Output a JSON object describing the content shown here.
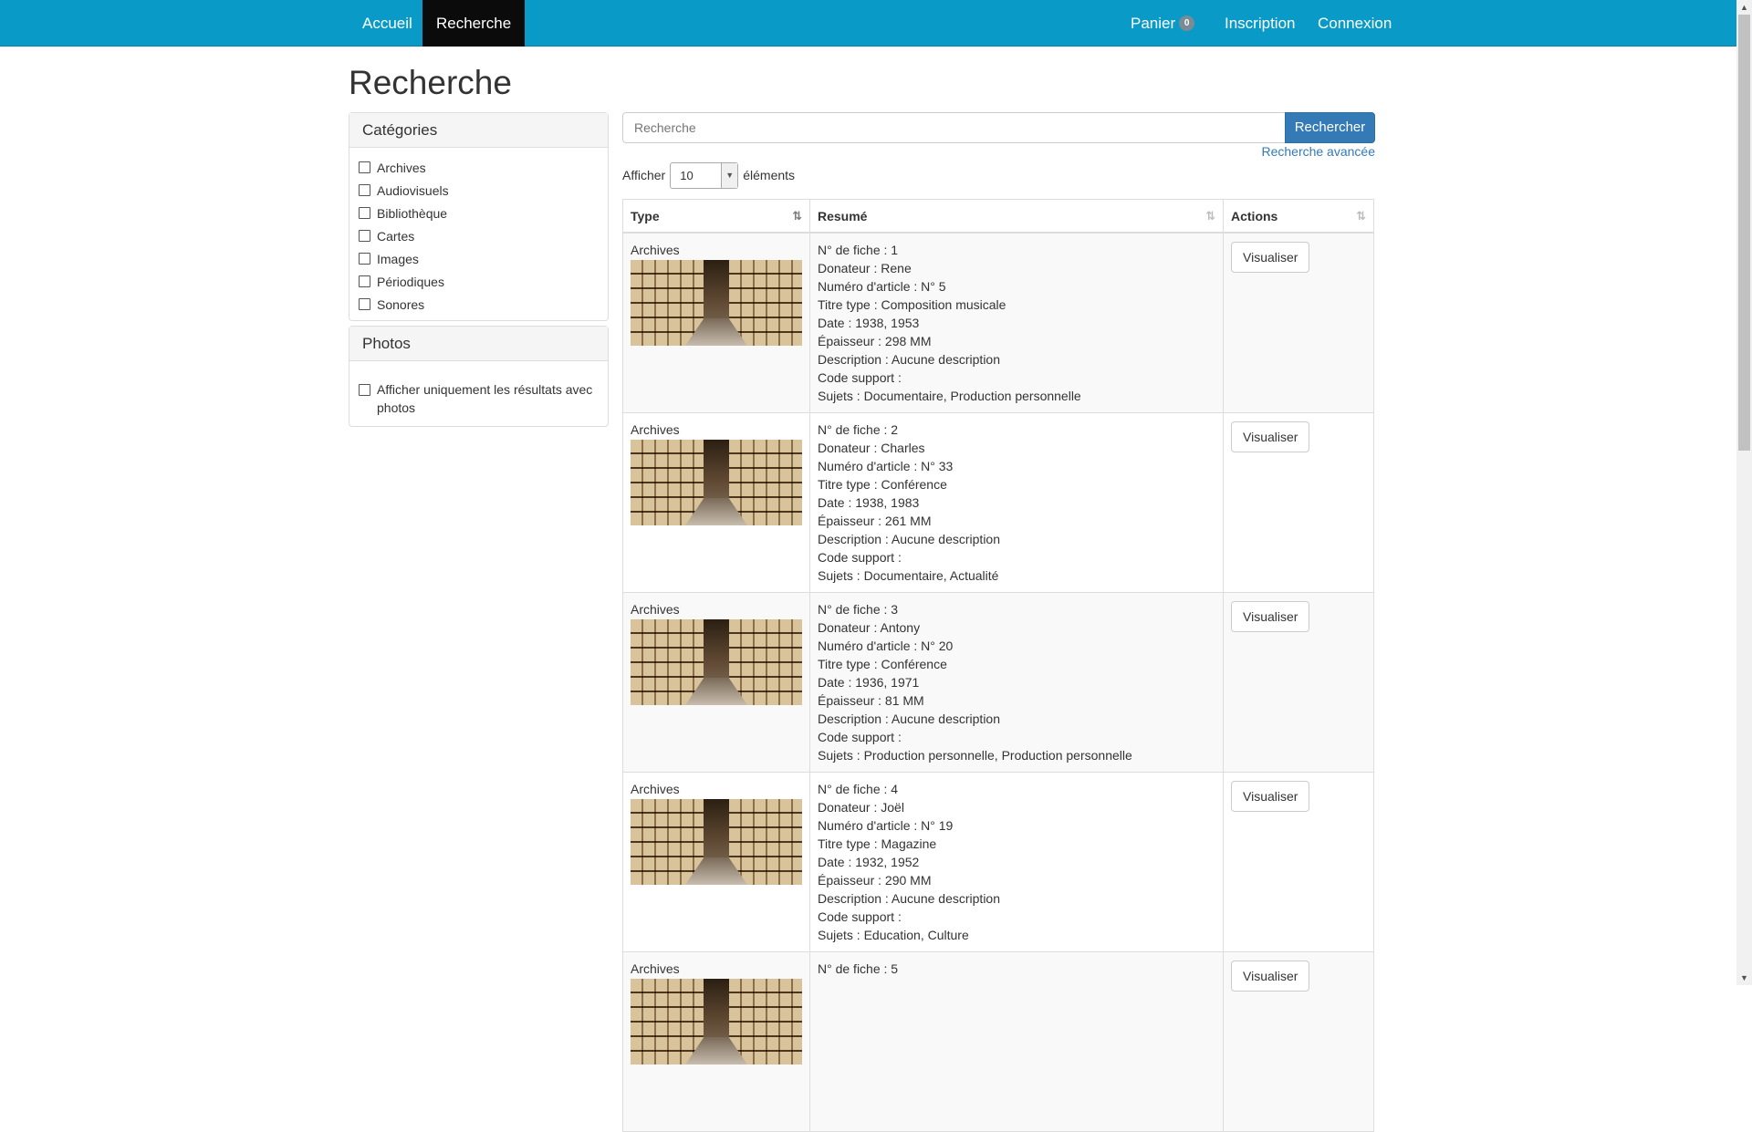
{
  "nav": {
    "home": "Accueil",
    "search": "Recherche",
    "cart": "Panier",
    "cart_count": "0",
    "register": "Inscription",
    "login": "Connexion"
  },
  "page_title": "Recherche",
  "categories": {
    "title": "Catégories",
    "items": [
      "Archives",
      "Audiovisuels",
      "Bibliothèque",
      "Cartes",
      "Images",
      "Périodiques",
      "Sonores"
    ]
  },
  "photos": {
    "title": "Photos",
    "option": "Afficher uniquement les résultats avec photos"
  },
  "search": {
    "placeholder": "Recherche",
    "button": "Rechercher",
    "advanced": "Recherche avancée"
  },
  "length": {
    "prefix": "Afficher",
    "value": "10",
    "suffix": "éléments"
  },
  "table": {
    "headers": [
      "Type",
      "Resumé",
      "Actions"
    ],
    "action_label": "Visualiser",
    "rows": [
      {
        "type": "Archives",
        "lines": [
          "N° de fiche : 1",
          "Donateur : Rene",
          "Numéro d'article : N° 5",
          "Titre type : Composition musicale",
          "Date : 1938, 1953",
          "Épaisseur : 298 MM",
          "Description : Aucune description",
          "Code support :",
          "Sujets : Documentaire, Production personnelle"
        ]
      },
      {
        "type": "Archives",
        "lines": [
          "N° de fiche : 2",
          "Donateur : Charles",
          "Numéro d'article : N° 33",
          "Titre type : Conférence",
          "Date : 1938, 1983",
          "Épaisseur : 261 MM",
          "Description : Aucune description",
          "Code support :",
          "Sujets : Documentaire, Actualité"
        ]
      },
      {
        "type": "Archives",
        "lines": [
          "N° de fiche : 3",
          "Donateur : Antony",
          "Numéro d'article : N° 20",
          "Titre type : Conférence",
          "Date : 1936, 1971",
          "Épaisseur : 81 MM",
          "Description : Aucune description",
          "Code support :",
          "Sujets : Production personnelle, Production personnelle"
        ]
      },
      {
        "type": "Archives",
        "lines": [
          "N° de fiche : 4",
          "Donateur : Joël",
          "Numéro d'article : N° 19",
          "Titre type : Magazine",
          "Date : 1932, 1952",
          "Épaisseur : 290 MM",
          "Description : Aucune description",
          "Code support :",
          "Sujets : Education, Culture"
        ]
      },
      {
        "type": "Archives",
        "lines": [
          "N° de fiche : 5"
        ]
      }
    ]
  }
}
